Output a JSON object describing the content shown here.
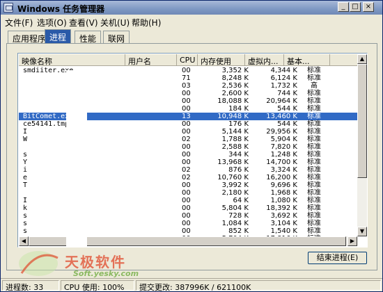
{
  "window": {
    "title": "Windows 任务管理器"
  },
  "menubar": {
    "items": [
      "文件(F)",
      "选项(O)",
      "查看(V)",
      "关机(U)",
      "帮助(H)"
    ]
  },
  "tabs": [
    "应用程序",
    "进程",
    "性能",
    "联网"
  ],
  "active_tab": "进程",
  "columns": [
    "映像名称",
    "用户名",
    "CPU",
    "内存使用",
    "虚拟内...",
    "基本..."
  ],
  "processes": [
    {
      "name": "smdiiter.exe",
      "cpu": "00",
      "mem": "3,352 K",
      "vm": "4,344 K",
      "base": "标准"
    },
    {
      "name": "",
      "cpu": "71",
      "mem": "8,248 K",
      "vm": "6,124 K",
      "base": "标准"
    },
    {
      "name": "",
      "cpu": "03",
      "mem": "2,536 K",
      "vm": "1,732 K",
      "base": "高"
    },
    {
      "name": "",
      "cpu": "00",
      "mem": "2,600 K",
      "vm": "744 K",
      "base": "标准"
    },
    {
      "name": "",
      "cpu": "00",
      "mem": "18,088 K",
      "vm": "20,964 K",
      "base": "标准"
    },
    {
      "name": "",
      "cpu": "00",
      "mem": "184 K",
      "vm": "544 K",
      "base": "标准"
    },
    {
      "name": "BitComet.exe",
      "cpu": "13",
      "mem": "10,948 K",
      "vm": "13,460 K",
      "base": "标准",
      "selected": true
    },
    {
      "name": "ce54141.tmp",
      "cpu": "00",
      "mem": "176 K",
      "vm": "544 K",
      "base": "标准"
    },
    {
      "name": "I",
      "cpu": "00",
      "mem": "5,144 K",
      "vm": "29,956 K",
      "base": "标准"
    },
    {
      "name": "W",
      "cpu": "02",
      "mem": "1,788 K",
      "vm": "5,904 K",
      "base": "标准"
    },
    {
      "name": "",
      "cpu": "00",
      "mem": "2,588 K",
      "vm": "7,820 K",
      "base": "标准"
    },
    {
      "name": "s",
      "cpu": "00",
      "mem": "344 K",
      "vm": "1,248 K",
      "base": "标准"
    },
    {
      "name": "Y",
      "cpu": "00",
      "mem": "13,968 K",
      "vm": "14,700 K",
      "base": "标准"
    },
    {
      "name": "i",
      "cpu": "02",
      "mem": "876 K",
      "vm": "3,324 K",
      "base": "标准"
    },
    {
      "name": "e",
      "cpu": "02",
      "mem": "10,760 K",
      "vm": "16,200 K",
      "base": "标准"
    },
    {
      "name": "T",
      "cpu": "00",
      "mem": "3,992 K",
      "vm": "9,696 K",
      "base": "标准"
    },
    {
      "name": "",
      "cpu": "00",
      "mem": "2,180 K",
      "vm": "1,968 K",
      "base": "标准"
    },
    {
      "name": "I",
      "cpu": "00",
      "mem": "64 K",
      "vm": "1,080 K",
      "base": "标准"
    },
    {
      "name": "k",
      "cpu": "00",
      "mem": "5,804 K",
      "vm": "18,392 K",
      "base": "标准"
    },
    {
      "name": "s",
      "cpu": "00",
      "mem": "728 K",
      "vm": "3,692 K",
      "base": "标准"
    },
    {
      "name": "s",
      "cpu": "00",
      "mem": "1,084 K",
      "vm": "3,104 K",
      "base": "标准"
    },
    {
      "name": "s",
      "cpu": "00",
      "mem": "852 K",
      "vm": "1,540 K",
      "base": "标准"
    },
    {
      "name": "s",
      "cpu": "00",
      "mem": "5,704 K",
      "vm": "17,816 K",
      "base": "标准"
    }
  ],
  "end_process_label": "结束进程(E)",
  "status": {
    "process_count": "进程数: 33",
    "cpu_usage": "CPU 使用: 100%",
    "commit": "提交更改: 387996K / 621100K"
  },
  "watermark": {
    "text": "天极软件",
    "url": "Soft.yesky.com"
  }
}
